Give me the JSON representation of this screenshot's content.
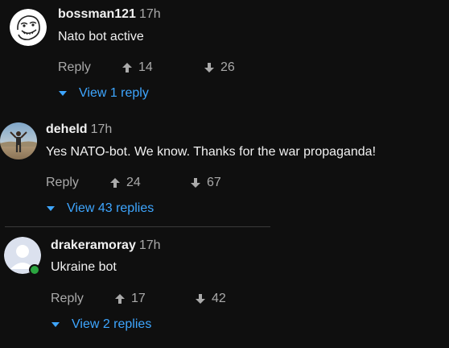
{
  "comments": [
    {
      "username": "bossman121",
      "time": "17h",
      "text": "Nato bot active",
      "reply_label": "Reply",
      "likes": "14",
      "dislikes": "26",
      "replies_link": "View 1 reply",
      "avatar": "troll-face-icon"
    },
    {
      "username": "deheld",
      "time": "17h",
      "text": "Yes NATO-bot. We know. Thanks for the war propaganda!",
      "reply_label": "Reply",
      "likes": "24",
      "dislikes": "67",
      "replies_link": "View 43 replies",
      "avatar": "photo-avatar"
    },
    {
      "username": "drakeramoray",
      "time": "17h",
      "text": "Ukraine bot",
      "reply_label": "Reply",
      "likes": "17",
      "dislikes": "42",
      "replies_link": "View 2 replies",
      "avatar": "default-user-icon"
    }
  ],
  "colors": {
    "background": "#0f0f0f",
    "link": "#3ea6ff",
    "muted": "#aaaaaa",
    "online": "#2ba640"
  }
}
